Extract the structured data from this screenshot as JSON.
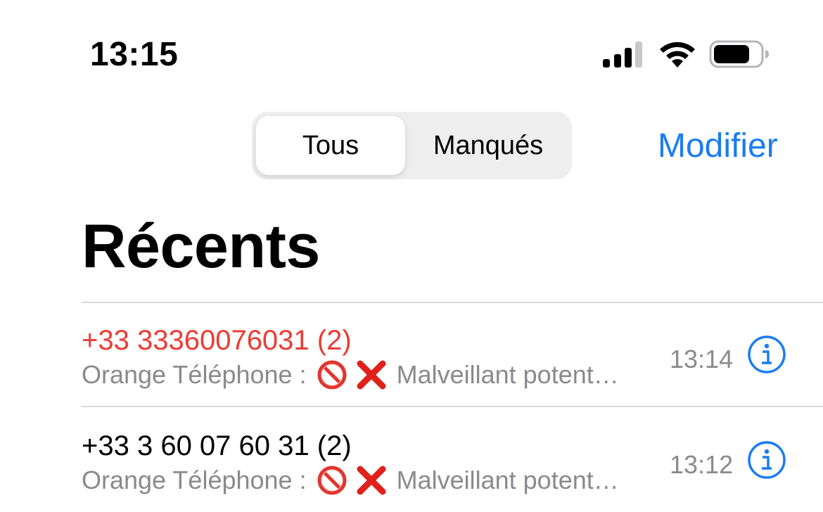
{
  "status_bar": {
    "time": "13:15",
    "icons": [
      "cellular-signal-icon",
      "wifi-icon",
      "battery-icon"
    ]
  },
  "segmented": {
    "selected": "Tous",
    "options": [
      "Tous",
      "Manqués"
    ]
  },
  "nav": {
    "edit_label": "Modifier"
  },
  "title": "Récents",
  "calls": [
    {
      "number": "+33 33360076031 (2)",
      "missed": true,
      "subtitle_prefix": "Orange Téléphone :",
      "subtitle_suffix": "Malveillant potent…",
      "subtitle_icons": [
        "no-entry-emoji",
        "cross-mark-emoji"
      ],
      "time": "13:14"
    },
    {
      "number": "+33 3 60 07 60 31 (2)",
      "missed": false,
      "subtitle_prefix": "Orange Téléphone :",
      "subtitle_suffix": "Malveillant potent…",
      "subtitle_icons": [
        "no-entry-emoji",
        "cross-mark-emoji"
      ],
      "time": "13:12"
    }
  ],
  "colors": {
    "accent": "#1a7cf1",
    "missed": "#eb3c34",
    "secondary_text": "#8a8a8e",
    "segment_bg": "#eeeeef"
  }
}
